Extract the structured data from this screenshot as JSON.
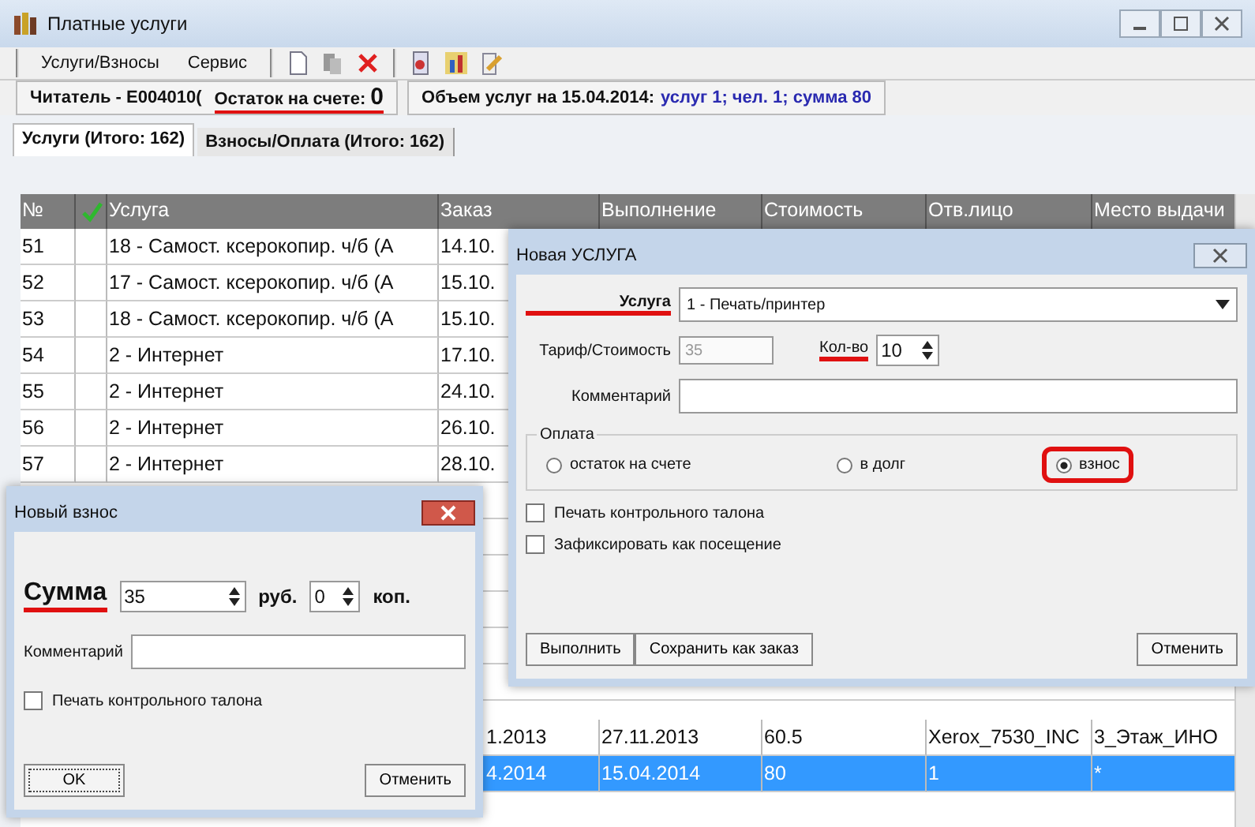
{
  "window": {
    "title": "Платные услуги"
  },
  "menu": [
    "Услуги/Взносы",
    "Сервис"
  ],
  "info_bar": {
    "reader": "Читатель - E004010(",
    "balance_label": "Остаток на счете:",
    "balance_value": "0",
    "balance_highlighted": true,
    "summary_label": "Объем услуг на 15.04.2014:",
    "summary_value": "услуг 1; чел. 1; сумма 80"
  },
  "tabs": [
    {
      "label": "Услуги (Итого: 162)",
      "selected": true
    },
    {
      "label": "Взносы/Оплата (Итого: 162)",
      "selected": false
    }
  ],
  "table": {
    "columns": [
      {
        "kind": "text",
        "label": "№"
      },
      {
        "kind": "check"
      },
      {
        "kind": "text",
        "label": "Услуга"
      },
      {
        "kind": "text",
        "label": "Заказ"
      },
      {
        "kind": "text",
        "label": "Выполнение"
      },
      {
        "kind": "text",
        "label": "Стоимость"
      },
      {
        "kind": "text",
        "label": "Отв.лицо"
      },
      {
        "kind": "text",
        "label": "Место выдачи"
      }
    ],
    "rows": [
      {
        "no": "51",
        "service": "18 - Самост. ксерокопир. ч/б (А",
        "order": "14.10.",
        "selected": false
      },
      {
        "no": "52",
        "service": "17 - Самост. ксерокопир. ч/б (А",
        "order": "15.10.",
        "selected": false
      },
      {
        "no": "53",
        "service": "18 - Самост. ксерокопир. ч/б (А",
        "order": "15.10.",
        "selected": false
      },
      {
        "no": "54",
        "service": "2 - Интернет",
        "order": "17.10.",
        "selected": false
      },
      {
        "no": "55",
        "service": "2 - Интернет",
        "order": "24.10.",
        "selected": false
      },
      {
        "no": "56",
        "service": "2 - Интернет",
        "order": "26.10.",
        "selected": false
      },
      {
        "no": "57",
        "service": "2 - Интернет",
        "order": "28.10.",
        "selected": false
      }
    ],
    "lower_rows": [
      {
        "order": "1.2013",
        "done": "27.11.2013",
        "cost": "60.5",
        "person": "Xerox_7530_INC",
        "place": "3_Этаж_ИНО",
        "selected": false
      },
      {
        "order": "4.2014",
        "done": "15.04.2014",
        "cost": "80",
        "person": "1",
        "place": "*",
        "selected": true
      }
    ]
  },
  "service_dialog": {
    "title": "Новая УСЛУГА",
    "service_label": {
      "text": "Услуга",
      "highlighted": true
    },
    "service_value": "1 - Печать/принтер",
    "tariff_label": "Тариф/Стоимость",
    "tariff_value": "35",
    "tariff_disabled": true,
    "qty_label": {
      "text": "Кол-во",
      "highlighted": true
    },
    "qty_value": "10",
    "comment_label": "Комментарий",
    "payment_group": "Оплата",
    "payment_options": [
      {
        "label": "остаток на счете",
        "selected": false,
        "highlighted": false
      },
      {
        "label": "в долг",
        "selected": false,
        "highlighted": false
      },
      {
        "label": "взнос",
        "selected": true,
        "highlighted": true
      }
    ],
    "checkboxes": [
      {
        "label": "Печать контрольного талона",
        "checked": false
      },
      {
        "label": "Зафиксировать как посещение",
        "checked": false
      }
    ],
    "buttons": [
      "Выполнить",
      "Сохранить как заказ",
      "Отменить"
    ]
  },
  "payment_dialog": {
    "title": "Новый взнос",
    "amount_label": {
      "text": "Сумма",
      "highlighted": true
    },
    "rub_value": "35",
    "rub_unit": "руб.",
    "kop_value": "0",
    "kop_unit": "коп.",
    "comment_label": "Комментарий",
    "checkbox": {
      "label": "Печать контрольного талона",
      "checked": false
    },
    "buttons": [
      "OK",
      "Отменить"
    ]
  }
}
